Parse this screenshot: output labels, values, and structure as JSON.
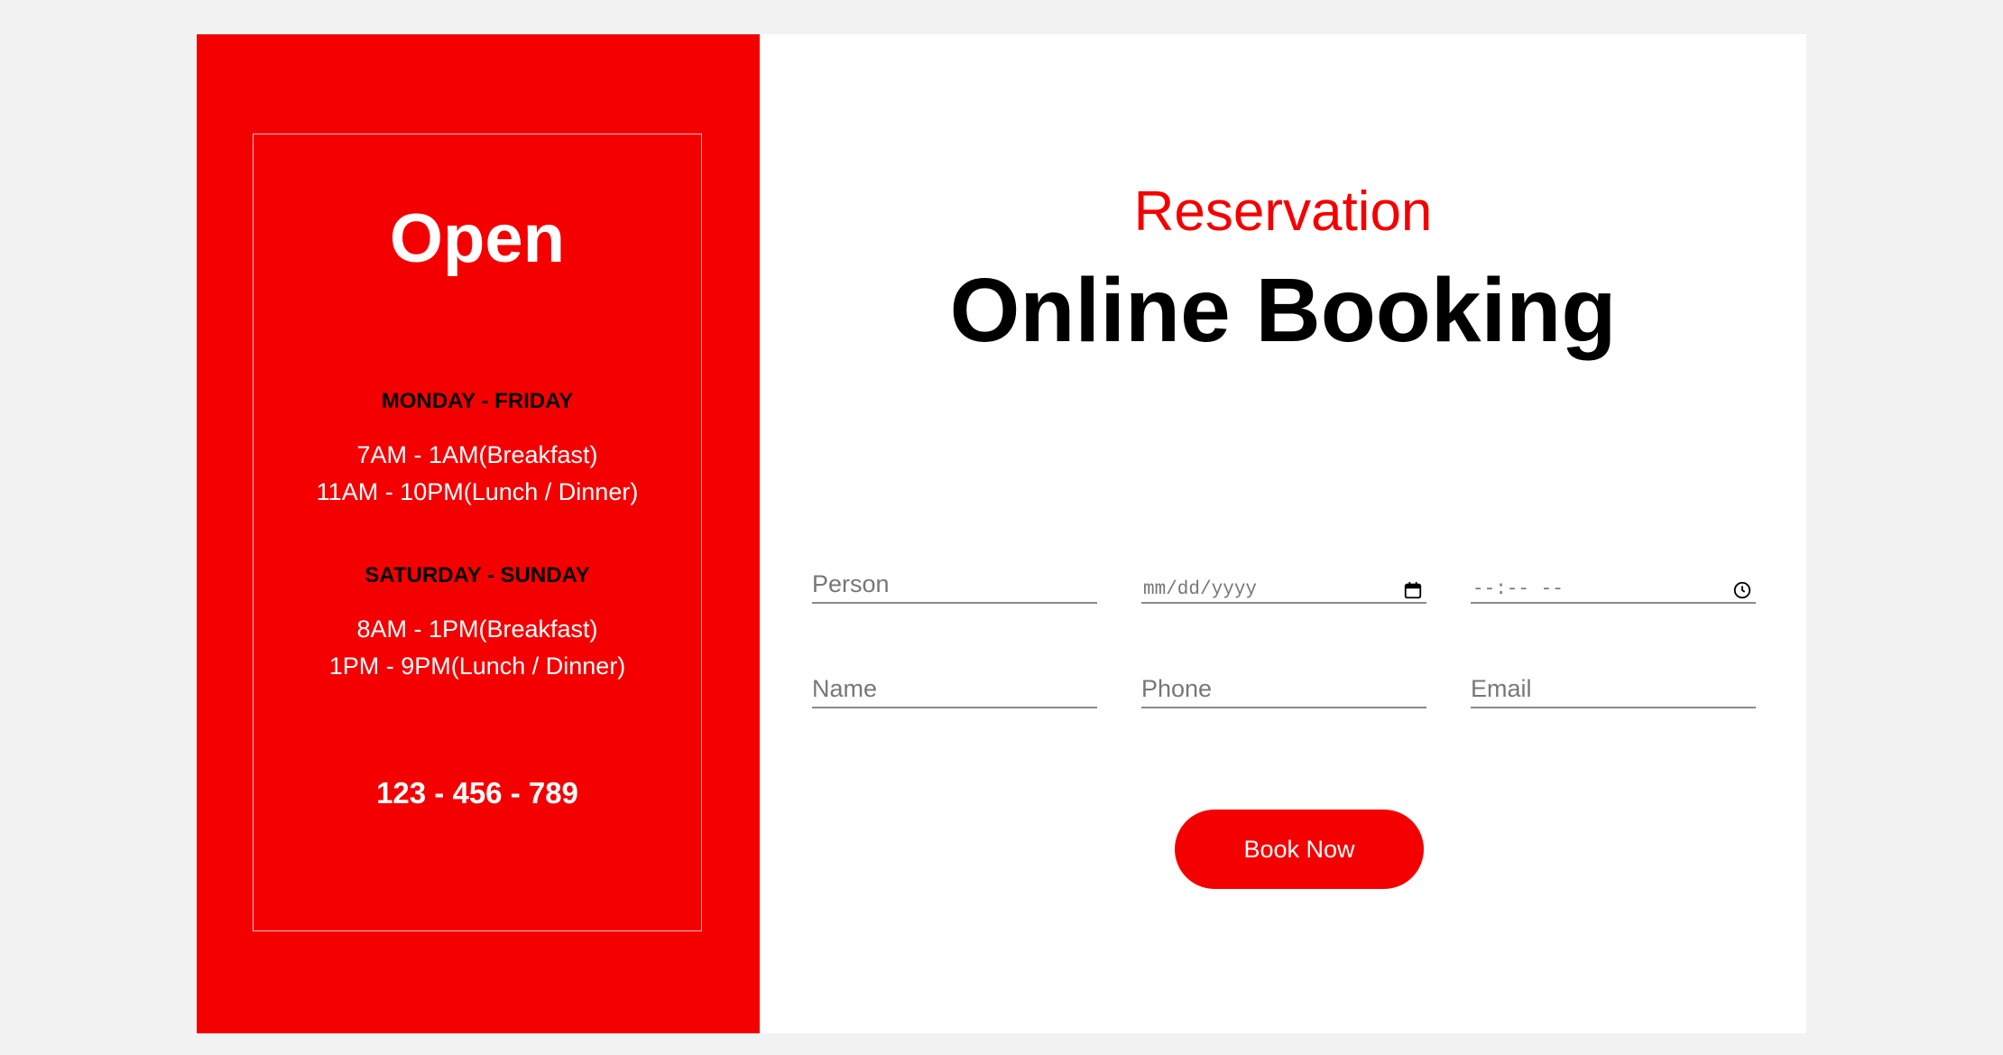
{
  "hours_panel": {
    "title": "Open",
    "weekdays": {
      "heading": "MONDAY - FRIDAY",
      "lines": [
        "7AM - 1AM(Breakfast)",
        "11AM - 10PM(Lunch / Dinner)"
      ]
    },
    "weekend": {
      "heading": "SATURDAY - SUNDAY",
      "lines": [
        "8AM - 1PM(Breakfast)",
        "1PM - 9PM(Lunch / Dinner)"
      ]
    },
    "phone": "123 - 456 - 789"
  },
  "booking": {
    "subtitle": "Reservation",
    "title": "Online Booking",
    "person_placeholder": "Person",
    "date_placeholder": "mm/dd/yyyy",
    "date_icon": "calendar-icon",
    "time_placeholder": "--:-- --",
    "time_icon": "clock-icon",
    "name_placeholder": "Name",
    "phone_placeholder": "Phone",
    "email_placeholder": "Email",
    "submit_label": "Book Now"
  },
  "colors": {
    "accent": "#f50000",
    "page_background": "#f2f2f2",
    "card_background": "#ffffff",
    "heading_text": "#000000",
    "panel_text": "#ffffff"
  }
}
